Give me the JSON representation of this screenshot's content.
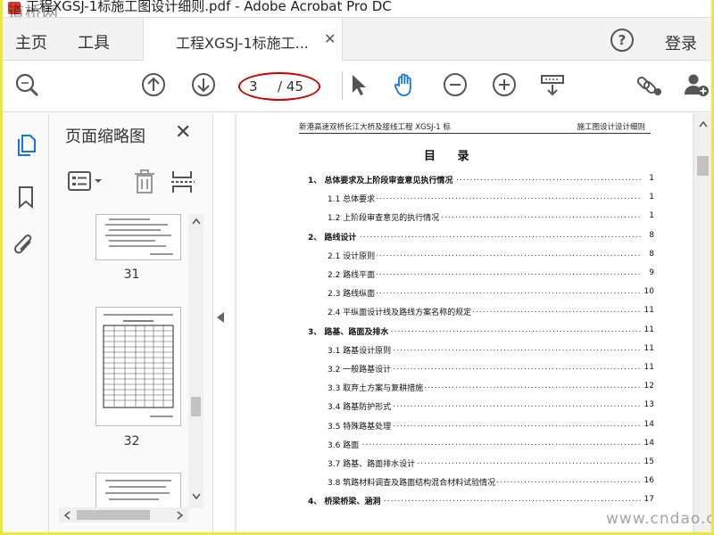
{
  "window": {
    "title": "工程XGSJ-1标施工图设计细则.pdf - Adobe Acrobat Pro DC",
    "watermark": "道桥网"
  },
  "tabs": {
    "home": "主页",
    "tools": "工具",
    "document": "工程XGSJ-1标施工...",
    "login": "登录"
  },
  "toolbar": {
    "current_page": "3",
    "total_pages": "/ 45"
  },
  "thumbnails": {
    "header": "页面缩略图",
    "items": [
      {
        "label": "31"
      },
      {
        "label": "32"
      }
    ]
  },
  "document": {
    "header_left": "新港高速双桥长江大桥及接线工程 XGSJ-1 标",
    "header_right": "施工图设计设计细则",
    "toc_title": "目  录",
    "toc": [
      {
        "level": 1,
        "text": "1、 总体要求及上阶段审查意见执行情况",
        "page": "1"
      },
      {
        "level": 2,
        "text": "1.1 总体要求",
        "page": "1"
      },
      {
        "level": 2,
        "text": "1.2 上阶段审查意见的执行情况",
        "page": "1"
      },
      {
        "level": 1,
        "text": "2、 路线设计",
        "page": "8"
      },
      {
        "level": 2,
        "text": "2.1 设计原则",
        "page": "8"
      },
      {
        "level": 2,
        "text": "2.2 路线平面",
        "page": "9"
      },
      {
        "level": 2,
        "text": "2.3 路线纵面",
        "page": "10"
      },
      {
        "level": 2,
        "text": "2.4 平纵面设计线及路线方案名称的规定",
        "page": "11"
      },
      {
        "level": 1,
        "text": "3、 路基、路面及排水",
        "page": "11"
      },
      {
        "level": 2,
        "text": "3.1 路基设计原则",
        "page": "11"
      },
      {
        "level": 2,
        "text": "3.2 一般路基设计",
        "page": "11"
      },
      {
        "level": 2,
        "text": "3.3 取弃土方案与复耕措施",
        "page": "12"
      },
      {
        "level": 2,
        "text": "3.4 路基防护形式",
        "page": "13"
      },
      {
        "level": 2,
        "text": "3.5 特殊路基处理",
        "page": "14"
      },
      {
        "level": 2,
        "text": "3.6 路面",
        "page": "14"
      },
      {
        "level": 2,
        "text": "3.7 路基、路面排水设计",
        "page": "15"
      },
      {
        "level": 2,
        "text": "3.8 筑路材料调查及路面结构混合材料试验情况",
        "page": "16"
      },
      {
        "level": 1,
        "text": "4、 桥梁桥梁、涵洞",
        "page": "17"
      }
    ]
  },
  "footer_watermark": "www.cndao.com",
  "colors": {
    "accent": "#1473e6",
    "annotation": "#d40000",
    "frame": "#e9e93a"
  }
}
